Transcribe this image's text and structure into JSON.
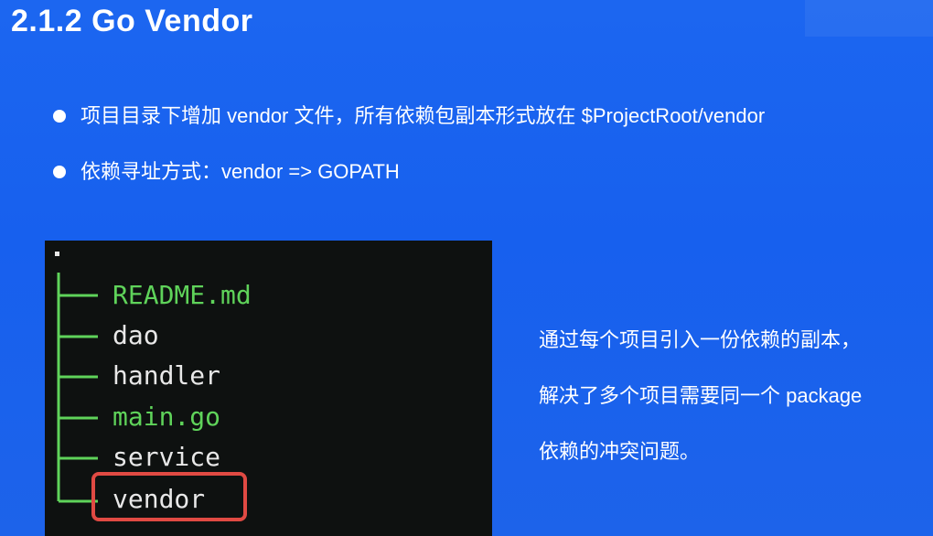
{
  "slide": {
    "title": "2.1.2 Go Vendor",
    "bullets": [
      "项目目录下增加 vendor 文件，所有依赖包副本形式放在 $ProjectRoot/vendor",
      "依赖寻址方式：vendor => GOPATH"
    ],
    "side_note": [
      "通过每个项目引入一份依赖的副本，",
      "解决了多个项目需要同一个 package",
      "依赖的冲突问题。"
    ]
  },
  "terminal": {
    "items": [
      {
        "name": "README.md",
        "color": "#5fd35a"
      },
      {
        "name": "dao",
        "color": "#e8e8e8"
      },
      {
        "name": "handler",
        "color": "#e8e8e8"
      },
      {
        "name": "main.go",
        "color": "#5fd35a"
      },
      {
        "name": "service",
        "color": "#e8e8e8"
      },
      {
        "name": "vendor",
        "color": "#e8e8e8"
      }
    ],
    "line_color": "#5fd35a",
    "highlight_color": "#e04a43",
    "highlighted": "vendor"
  }
}
